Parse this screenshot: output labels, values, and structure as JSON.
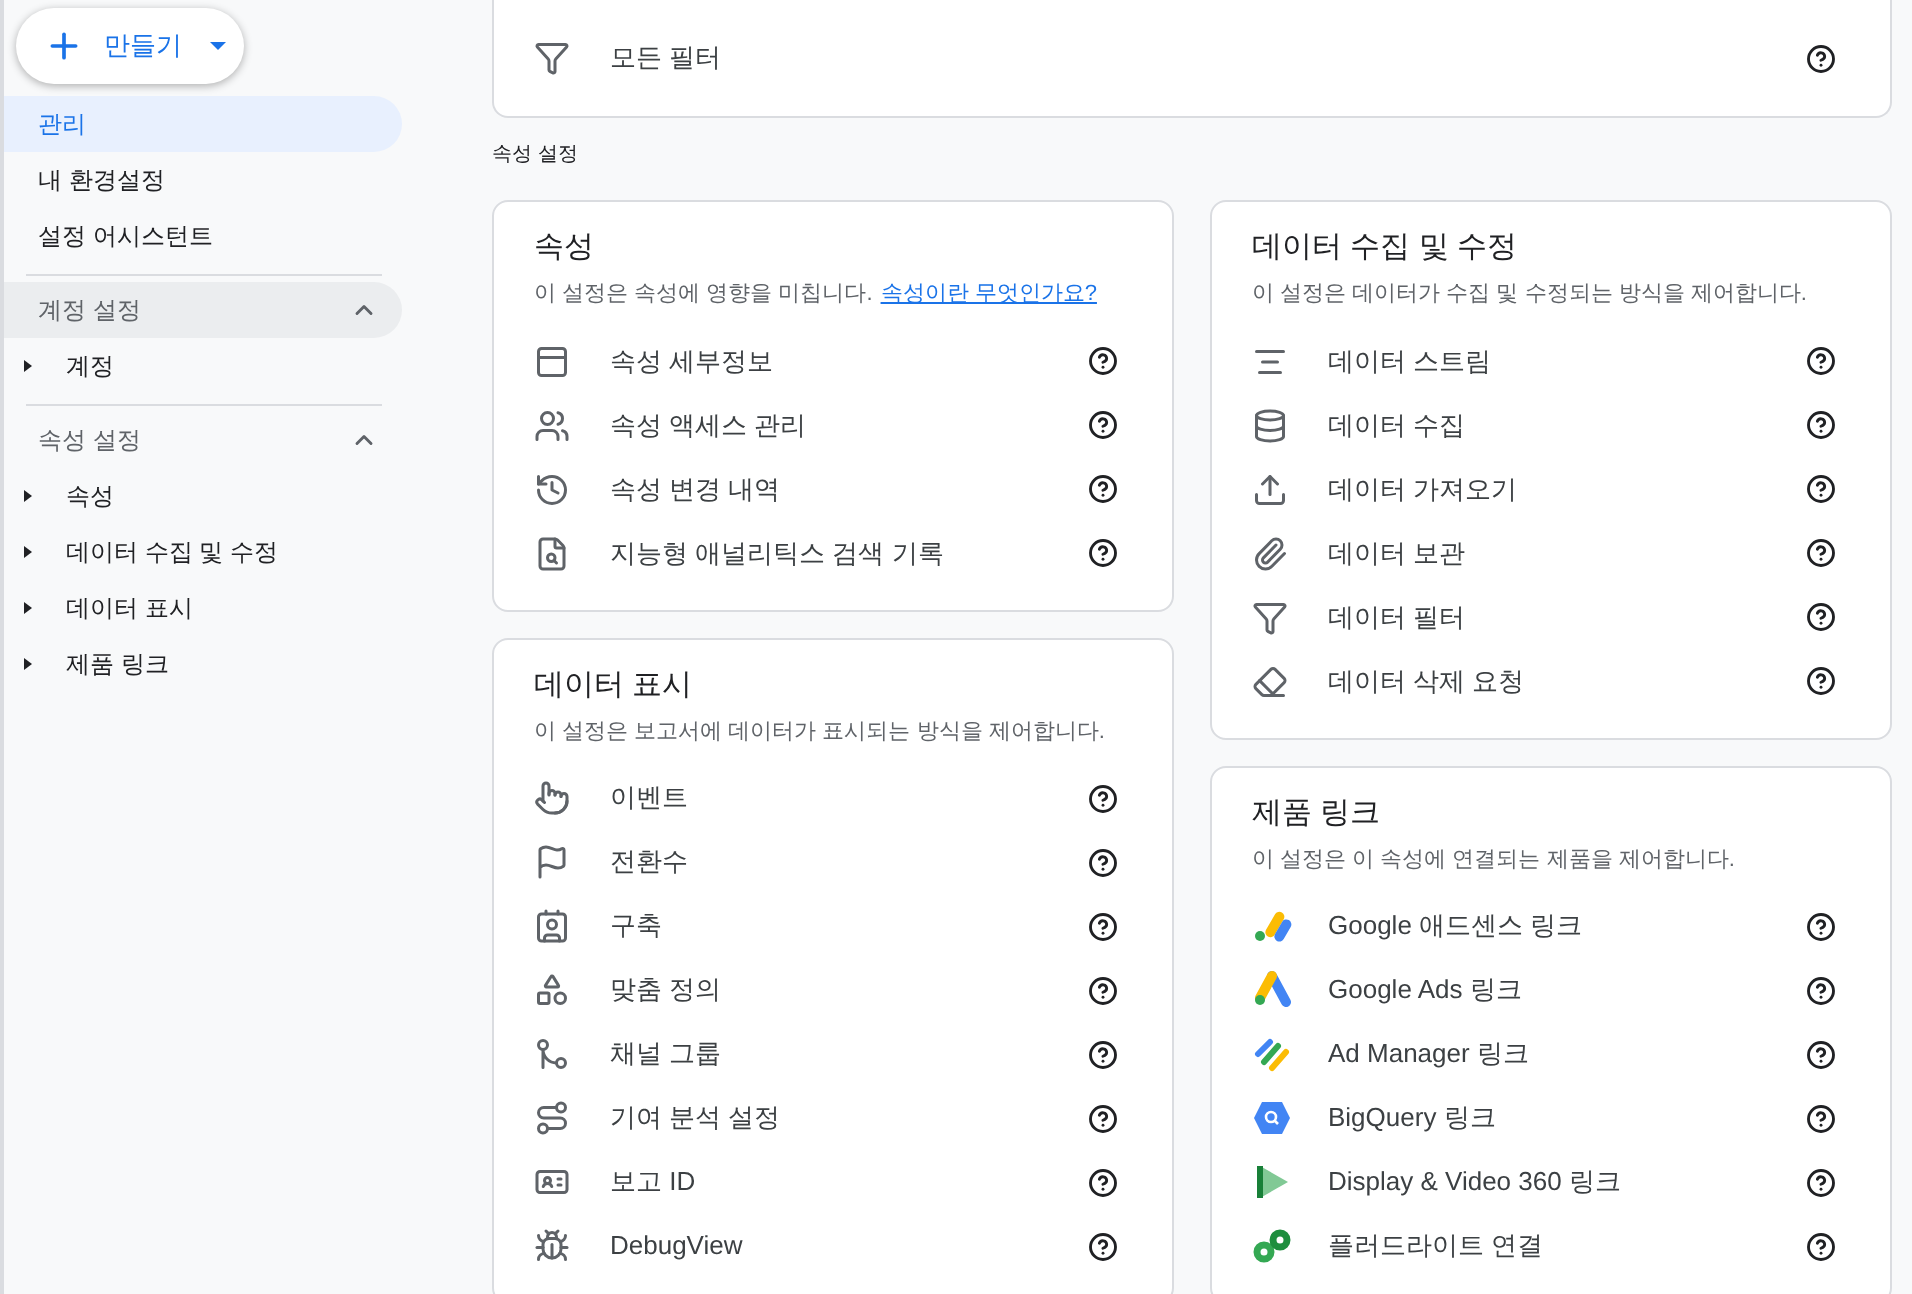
{
  "sidebar": {
    "create_button": {
      "label": "만들기"
    },
    "nav_items": [
      {
        "label": "관리",
        "selected": true
      },
      {
        "label": "내 환경설정",
        "selected": false
      },
      {
        "label": "설정 어시스턴트",
        "selected": false
      }
    ],
    "sections": [
      {
        "title": "계정 설정",
        "expanded": true,
        "highlighted": true,
        "items": [
          {
            "label": "계정",
            "expanded": false
          }
        ]
      },
      {
        "title": "속성 설정",
        "expanded": true,
        "highlighted": false,
        "items": [
          {
            "label": "속성",
            "expanded": false
          },
          {
            "label": "데이터 수집 및 수정",
            "expanded": false
          },
          {
            "label": "데이터 표시",
            "expanded": false
          },
          {
            "label": "제품 링크",
            "expanded": false
          }
        ]
      }
    ]
  },
  "top_card": {
    "rows": [
      {
        "label": "모든 필터"
      }
    ]
  },
  "section_label": "속성 설정",
  "columns": [
    [
      {
        "title": "속성",
        "description": "이 설정은 속성에 영향을 미칩니다.",
        "link": "속성이란 무엇인가요?",
        "rows": [
          {
            "label": "속성 세부정보"
          },
          {
            "label": "속성 액세스 관리"
          },
          {
            "label": "속성 변경 내역"
          },
          {
            "label": "지능형 애널리틱스 검색 기록"
          }
        ]
      },
      {
        "title": "데이터 표시",
        "description": "이 설정은 보고서에 데이터가 표시되는 방식을 제어합니다.",
        "rows": [
          {
            "label": "이벤트"
          },
          {
            "label": "전환수"
          },
          {
            "label": "구축"
          },
          {
            "label": "맞춤 정의"
          },
          {
            "label": "채널 그룹"
          },
          {
            "label": "기여 분석 설정"
          },
          {
            "label": "보고 ID"
          },
          {
            "label": "DebugView"
          }
        ]
      }
    ],
    [
      {
        "title": "데이터 수집 및 수정",
        "description": "이 설정은 데이터가 수집 및 수정되는 방식을 제어합니다.",
        "rows": [
          {
            "label": "데이터 스트림"
          },
          {
            "label": "데이터 수집"
          },
          {
            "label": "데이터 가져오기"
          },
          {
            "label": "데이터 보관"
          },
          {
            "label": "데이터 필터"
          },
          {
            "label": "데이터 삭제 요청"
          }
        ]
      },
      {
        "title": "제품 링크",
        "description": "이 설정은 이 속성에 연결되는 제품을 제어합니다.",
        "rows": [
          {
            "label": "Google 애드센스 링크"
          },
          {
            "label": "Google Ads 링크"
          },
          {
            "label": "Ad Manager 링크"
          },
          {
            "label": "BigQuery 링크"
          },
          {
            "label": "Display & Video 360 링크"
          },
          {
            "label": "플러드라이트 연결"
          }
        ]
      }
    ]
  ]
}
